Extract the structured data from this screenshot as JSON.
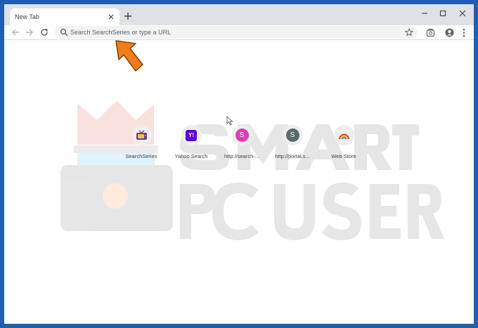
{
  "browser": {
    "tab": {
      "title": "New Tab"
    },
    "window_controls": [
      "minimize-icon",
      "maximize-icon",
      "close-icon"
    ]
  },
  "toolbar": {
    "omnibox_placeholder": "Search SearchSeries or type a URL"
  },
  "shortcuts": [
    {
      "label": "SearchSeries",
      "icon": "tv-icon",
      "color": "#6a3d7a"
    },
    {
      "label": "Yahoo Search",
      "badge": "Y!",
      "color": "#6001d2"
    },
    {
      "label": "http://search-...",
      "badge": "S",
      "color": "#e03cb4"
    },
    {
      "label": "http://portal.s...",
      "badge": "S",
      "color": "#5a6b6b"
    },
    {
      "label": "Web Store",
      "icon": "rainbow-icon"
    }
  ],
  "colors": {
    "frame": "#1f5fae",
    "arrow": "#f07d1a"
  }
}
